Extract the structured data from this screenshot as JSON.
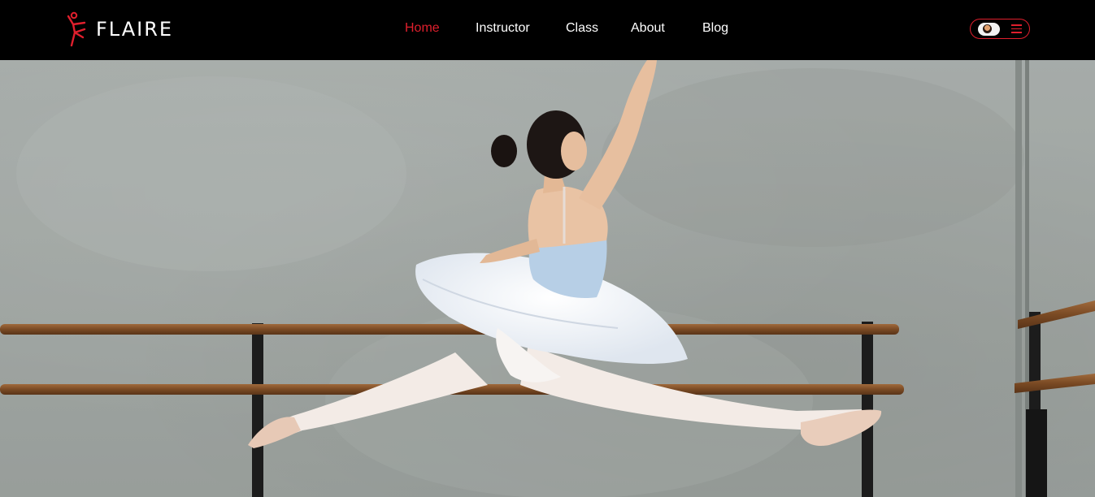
{
  "header": {
    "brand": "FLAIRE",
    "nav": [
      {
        "label": "Home",
        "active": true
      },
      {
        "label": "Instructor",
        "active": false
      },
      {
        "label": "Class",
        "active": false
      },
      {
        "label": "About",
        "active": false
      },
      {
        "label": "Blog",
        "active": false
      }
    ]
  },
  "colors": {
    "accent": "#e01f2d",
    "header_bg": "#000000",
    "nav_text": "#ffffff"
  },
  "icons": {
    "logo": "dancer-logo-icon",
    "menu": "hamburger-menu-icon",
    "user": "user-avatar"
  },
  "hero": {
    "image": "ballerina-leaping-in-studio-photo"
  }
}
